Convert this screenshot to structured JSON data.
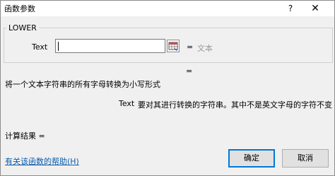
{
  "window": {
    "title": "函数参数",
    "help_glyph": "?",
    "close_glyph": "✕"
  },
  "function": {
    "name": "LOWER"
  },
  "argument": {
    "label": "Text",
    "value": "",
    "equals": "=",
    "hint": "文本"
  },
  "result_equals": "=",
  "description": "将一个文本字符串的所有字母转换为小写形式",
  "parameter_help": {
    "name": "Text",
    "text": "要对其进行转换的字符串。其中不是英文字母的字符不变"
  },
  "calc_result_label": "计算结果 =",
  "help_link": "有关该函数的帮助(H)",
  "buttons": {
    "ok": "确定",
    "cancel": "取消"
  },
  "icons": {
    "collapse": "range-select-icon"
  }
}
